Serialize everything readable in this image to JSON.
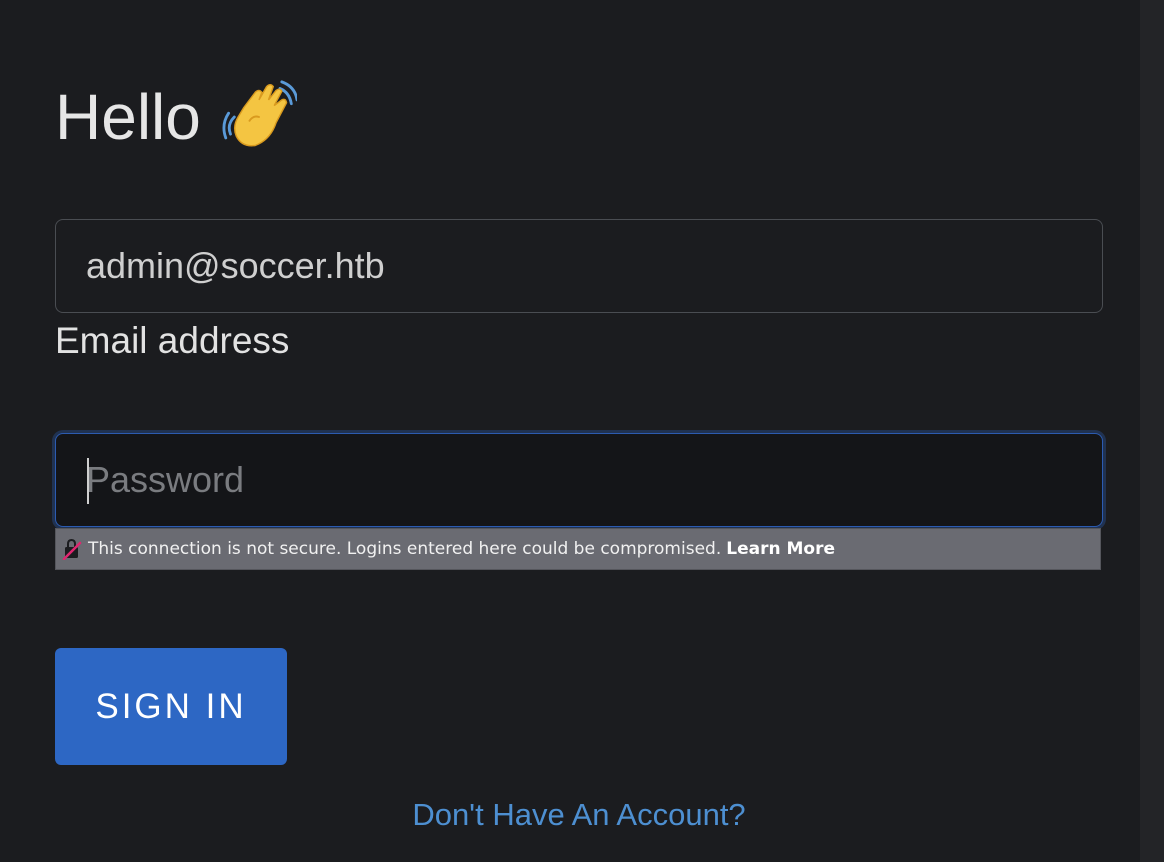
{
  "heading": {
    "text": "Hello",
    "emoji_icon": "waving-hand-icon"
  },
  "email": {
    "value": "admin@soccer.htb",
    "label": "Email address"
  },
  "password": {
    "placeholder": "Password",
    "value": ""
  },
  "security_warning": {
    "icon": "insecure-lock-icon",
    "message": "This connection is not secure. Logins entered here could be compromised.",
    "link_label": "Learn More"
  },
  "signin": {
    "label": "SIGN IN"
  },
  "signup_link": {
    "label": "Don't Have An Account?"
  },
  "colors": {
    "background": "#1b1c1f",
    "primary_button": "#2d67c4",
    "link": "#4d8fd1",
    "focus_border": "#2c5bb0",
    "warning_bar": "#6a6b72"
  }
}
